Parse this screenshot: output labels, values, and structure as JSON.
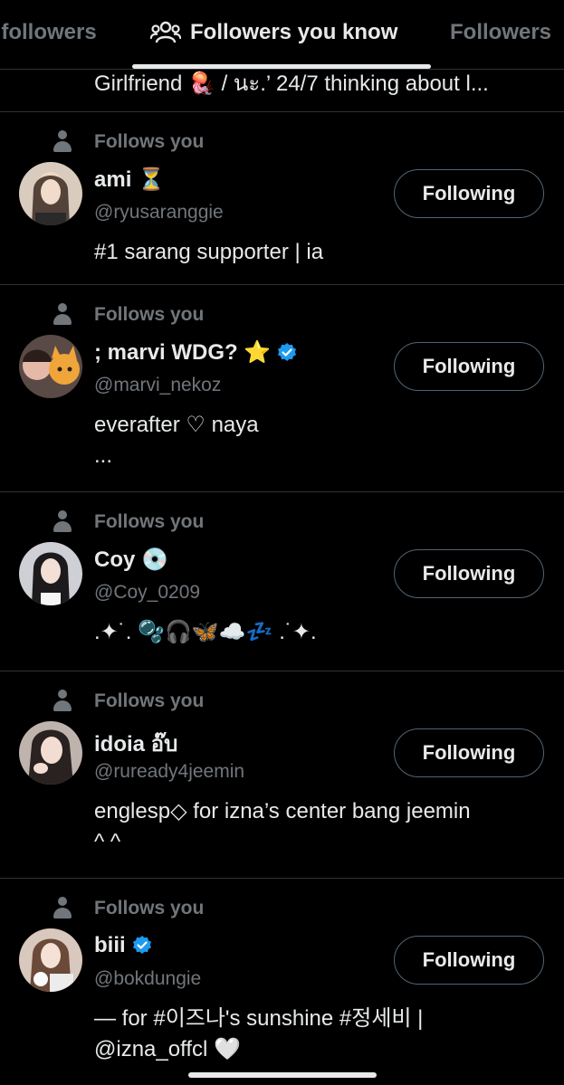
{
  "tabs": [
    {
      "label": "l followers"
    },
    {
      "label": "Followers you know"
    },
    {
      "label": "Followers"
    }
  ],
  "cut_bio": "Girlfriend 🪼 / นะ.’ 24/7 thinking about l...",
  "follows_you_label": "Follows you",
  "colors": {
    "background": "#000000",
    "text": "#e7e9ea",
    "muted": "#71767b",
    "verified": "#1d9bf0",
    "border": "#2f3336"
  },
  "users": [
    {
      "name": "ami ⏳",
      "handle": "@ryusaranggie",
      "bio_lines": [
        "#1 sarang supporter | ia"
      ],
      "verified": false,
      "button": "Following"
    },
    {
      "name": "; marvi WDG? ⭐",
      "handle": "@marvi_nekoz",
      "bio_lines": [
        "everafter ♡ naya",
        "..."
      ],
      "verified": true,
      "button": "Following"
    },
    {
      "name": "Coy 💿",
      "handle": "@Coy_0209",
      "bio_lines": [
        ".✦˙. 🫧🎧🦋☁️💤 .˙✦."
      ],
      "verified": false,
      "button": "Following"
    },
    {
      "name": "idoia อ๊บ",
      "handle": "@ruready4jeemin",
      "bio_lines": [
        "englesp◇ for izna’s center bang jeemin",
        "^ ^"
      ],
      "verified": false,
      "button": "Following"
    },
    {
      "name": "biii",
      "handle": "@bokdungie",
      "bio_lines": [
        "— for #이즈나's sunshine #정세비 |",
        "@izna_offcl 🤍"
      ],
      "verified": true,
      "button": "Following"
    }
  ]
}
